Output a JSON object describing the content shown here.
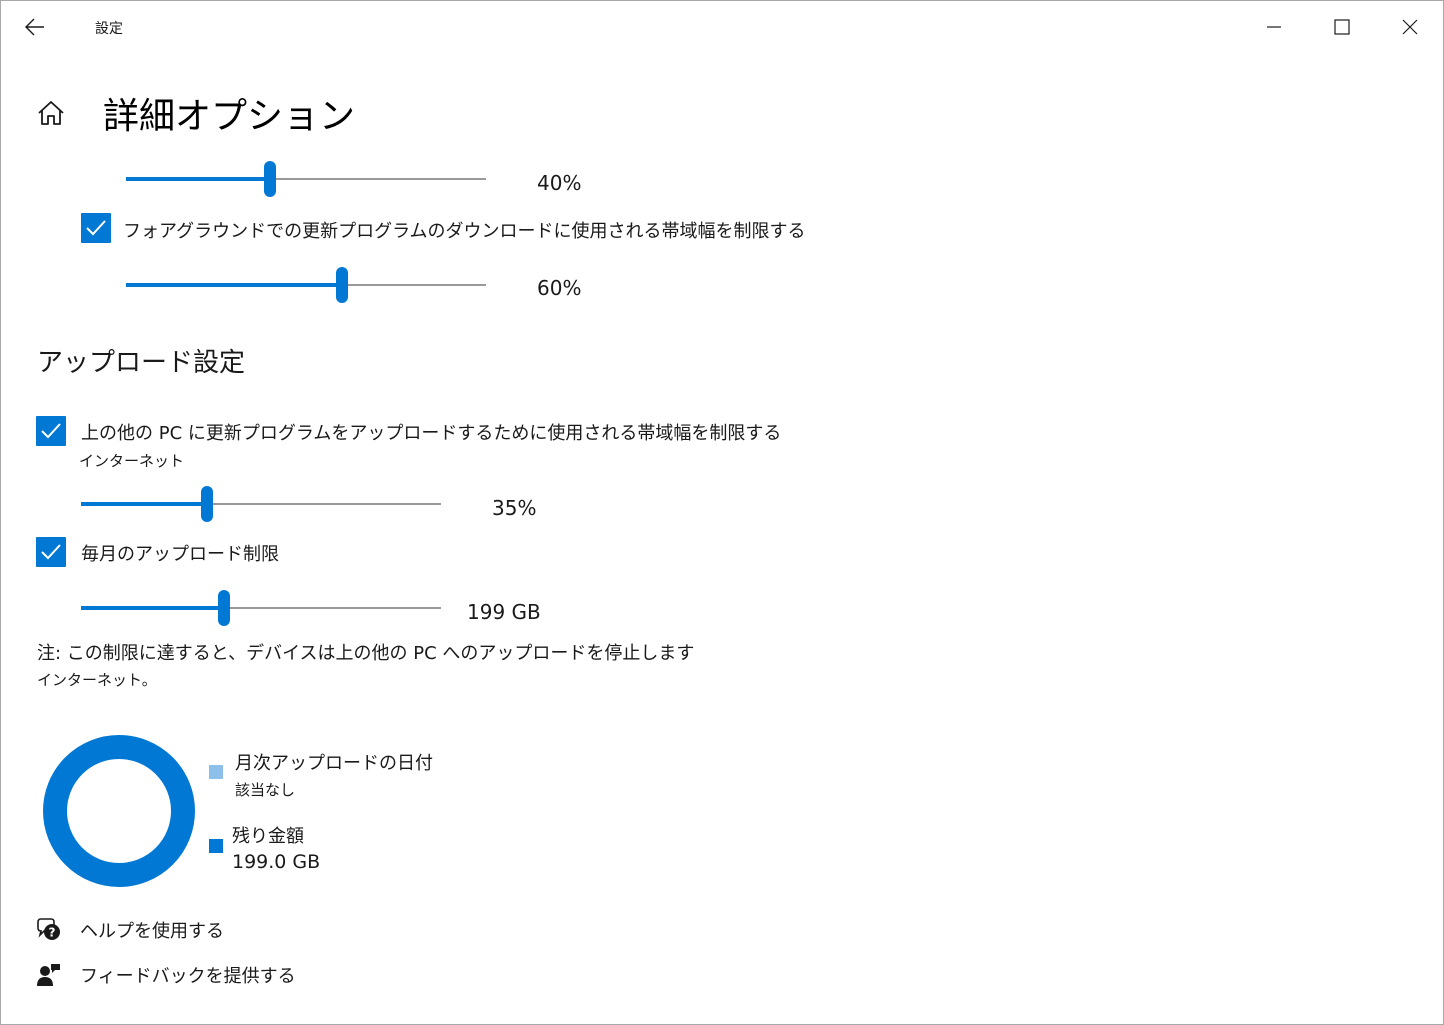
{
  "window": {
    "title": "設定",
    "back_icon": "back-arrow-icon",
    "minimize_icon": "minimize-icon",
    "maximize_icon": "maximize-icon",
    "close_icon": "close-icon"
  },
  "header": {
    "home_icon": "home-icon",
    "title": "詳細オプション"
  },
  "download": {
    "background_slider": {
      "value": 40,
      "value_text": "40%"
    },
    "foreground_checkbox": {
      "checked": true,
      "label": "フォアグラウンドでの更新プログラムのダウンロードに使用される帯域幅を制限する"
    },
    "foreground_slider": {
      "value": 60,
      "value_text": "60%"
    }
  },
  "upload": {
    "section_title": "アップロード設定",
    "limit_checkbox": {
      "checked": true,
      "label": "上の他の PC に更新プログラムをアップロードするために使用される帯域幅を制限する",
      "sublabel": "インターネット"
    },
    "limit_slider": {
      "value": 35,
      "value_text": "35%"
    },
    "monthly_checkbox": {
      "checked": true,
      "label": "毎月のアップロード制限"
    },
    "monthly_slider": {
      "value": 39.8,
      "value_text": "199 GB"
    },
    "note_line1": "注: この制限に達すると、デバイスは上の他の PC へのアップロードを停止します",
    "note_line2": "インターネット。"
  },
  "usage_chart": {
    "legend": [
      {
        "label": "月次アップロードの日付",
        "value": "該当なし",
        "color": "#8cbfea"
      },
      {
        "label": "残り金額",
        "value": "199.0 GB",
        "color": "#0078d4"
      }
    ],
    "ring_color": "#0078d4"
  },
  "links": {
    "help": {
      "icon": "help-chat-icon",
      "label": "ヘルプを使用する"
    },
    "feedback": {
      "icon": "feedback-icon",
      "label": "フィードバックを提供する"
    }
  }
}
